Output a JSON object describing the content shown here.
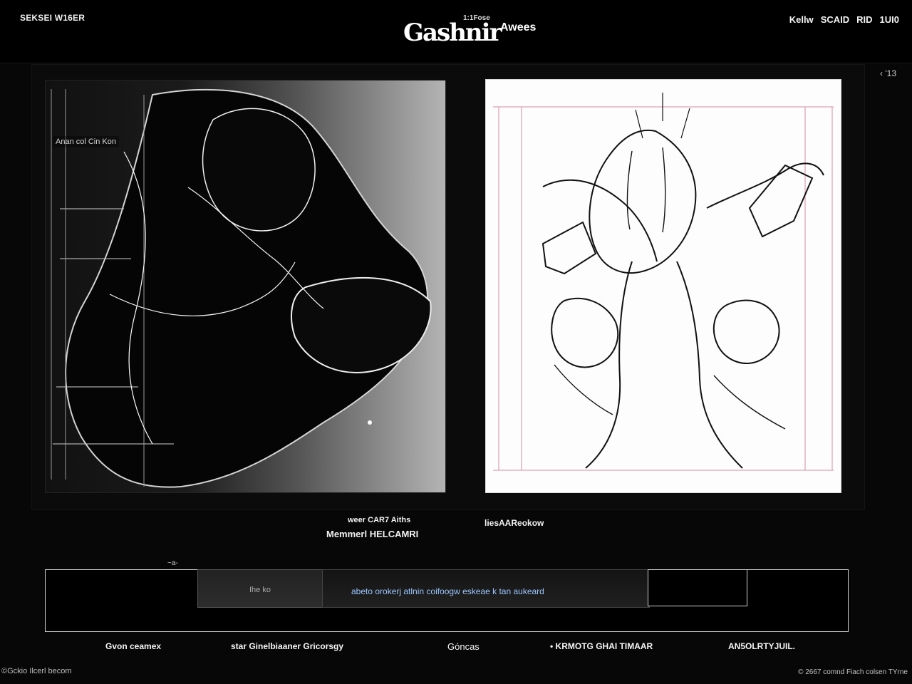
{
  "header": {
    "left_text": "SEKSEI W16ER",
    "logo_main": "Gashnir",
    "logo_tag": "1:1Fose",
    "logo_sub": "Awees",
    "right_items": [
      "Kellw",
      "SCAID",
      "RID",
      "1UI0"
    ]
  },
  "stage": {
    "corner_mark": "‹ '13",
    "left_panel_label": "Anan col Cin Kon",
    "right_panel_label": ""
  },
  "captions": {
    "line1": "weer CAR7 Aiths",
    "line2": "Memmerl HELCAMRI",
    "line3": "liesAAReokow"
  },
  "controls": {
    "mini_top": "~a-",
    "box_b_text": "Ihe ko",
    "box_c_text": "abeto orokerj atlnin coifoogw eskeae k tan aukeard"
  },
  "bottom_labels": {
    "item1": "Gvon ceamex",
    "item2": "star Ginelbiaaner Gricorsgy",
    "item3": "Góncas",
    "item4": "• KRMOTG GHAI TIMAAR",
    "item5": "AN5OLRTYJUIL."
  },
  "footer": {
    "left": "©Gckio Ilcerl becom",
    "right": "© 2667 comnd Fiach colsen TYrne"
  }
}
